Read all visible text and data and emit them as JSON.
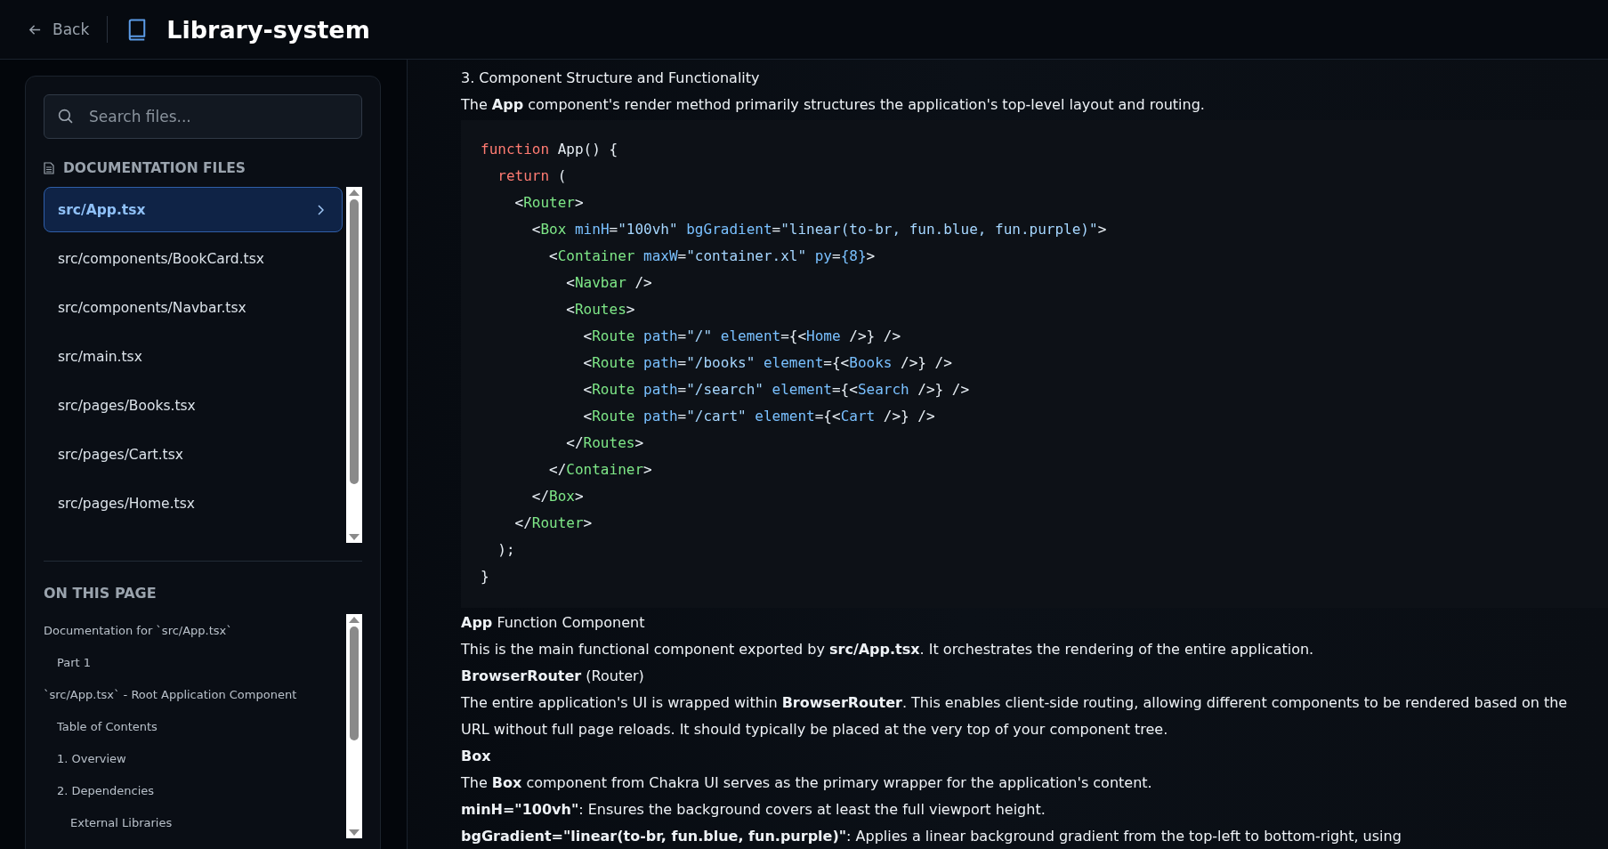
{
  "header": {
    "back": "Back",
    "title": "Library-system"
  },
  "sidebar": {
    "search": {
      "placeholder": "Search files..."
    },
    "files_heading": "DOCUMENTATION FILES",
    "files": [
      {
        "label": "src/App.tsx",
        "selected": true
      },
      {
        "label": "src/components/BookCard.tsx",
        "selected": false
      },
      {
        "label": "src/components/Navbar.tsx",
        "selected": false
      },
      {
        "label": "src/main.tsx",
        "selected": false
      },
      {
        "label": "src/pages/Books.tsx",
        "selected": false
      },
      {
        "label": "src/pages/Cart.tsx",
        "selected": false
      },
      {
        "label": "src/pages/Home.tsx",
        "selected": false
      }
    ],
    "toc_heading": "ON THIS PAGE",
    "toc": [
      {
        "label": "Documentation for `src/App.tsx`",
        "children": [
          {
            "label": "Part 1"
          }
        ]
      },
      {
        "label": "`src/App.tsx` - Root Application Component",
        "children": [
          {
            "label": "Table of Contents"
          },
          {
            "label": "1. Overview"
          },
          {
            "label": "2. Dependencies",
            "children": [
              {
                "label": "External Libraries"
              }
            ]
          }
        ]
      }
    ]
  },
  "content": {
    "blocks": [
      {
        "kind": "heading",
        "text": "3. Component Structure and Functionality"
      },
      {
        "kind": "para",
        "text": "The **App** component's render method primarily structures the application's top-level layout and routing."
      },
      {
        "kind": "code",
        "lines": [
          [
            {
              "kind": "keyword",
              "text": "function"
            },
            {
              "kind": "plain",
              "text": " App() {"
            }
          ],
          [
            {
              "kind": "keyword",
              "text": "  return"
            },
            {
              "kind": "plain",
              "text": " ("
            }
          ],
          [
            {
              "kind": "plain",
              "text": "    <"
            },
            {
              "kind": "tag",
              "text": "Router"
            },
            {
              "kind": "plain",
              "text": ">"
            }
          ],
          [
            {
              "kind": "plain",
              "text": "      <"
            },
            {
              "kind": "tag",
              "text": "Box"
            },
            {
              "kind": "attr",
              "text": " minH"
            },
            {
              "kind": "plain",
              "text": "="
            },
            {
              "kind": "string",
              "text": "\"100vh\""
            },
            {
              "kind": "attr",
              "text": " bgGradient"
            },
            {
              "kind": "plain",
              "text": "="
            },
            {
              "kind": "string",
              "text": "\"linear(to-br, fun.blue, fun.purple)\""
            },
            {
              "kind": "plain",
              "text": ">"
            }
          ],
          [
            {
              "kind": "plain",
              "text": "        <"
            },
            {
              "kind": "tag",
              "text": "Container"
            },
            {
              "kind": "attr",
              "text": " maxW"
            },
            {
              "kind": "plain",
              "text": "="
            },
            {
              "kind": "string",
              "text": "\"container.xl\""
            },
            {
              "kind": "attr",
              "text": " py"
            },
            {
              "kind": "plain",
              "text": "="
            },
            {
              "kind": "attr",
              "text": "{8}"
            },
            {
              "kind": "plain",
              "text": ">"
            }
          ],
          [
            {
              "kind": "plain",
              "text": "          <"
            },
            {
              "kind": "tag",
              "text": "Navbar"
            },
            {
              "kind": "plain",
              "text": " />"
            }
          ],
          [
            {
              "kind": "plain",
              "text": "          <"
            },
            {
              "kind": "tag",
              "text": "Routes"
            },
            {
              "kind": "plain",
              "text": ">"
            }
          ],
          [
            {
              "kind": "plain",
              "text": "            <"
            },
            {
              "kind": "tag",
              "text": "Route"
            },
            {
              "kind": "attr",
              "text": " path"
            },
            {
              "kind": "plain",
              "text": "="
            },
            {
              "kind": "string",
              "text": "\"/\""
            },
            {
              "kind": "attr",
              "text": " element"
            },
            {
              "kind": "plain",
              "text": "={<"
            },
            {
              "kind": "attr",
              "text": "Home"
            },
            {
              "kind": "plain",
              "text": " />} />"
            }
          ],
          [
            {
              "kind": "plain",
              "text": "            <"
            },
            {
              "kind": "tag",
              "text": "Route"
            },
            {
              "kind": "attr",
              "text": " path"
            },
            {
              "kind": "plain",
              "text": "="
            },
            {
              "kind": "string",
              "text": "\"/books\""
            },
            {
              "kind": "attr",
              "text": " element"
            },
            {
              "kind": "plain",
              "text": "={<"
            },
            {
              "kind": "attr",
              "text": "Books"
            },
            {
              "kind": "plain",
              "text": " />} />"
            }
          ],
          [
            {
              "kind": "plain",
              "text": "            <"
            },
            {
              "kind": "tag",
              "text": "Route"
            },
            {
              "kind": "attr",
              "text": " path"
            },
            {
              "kind": "plain",
              "text": "="
            },
            {
              "kind": "string",
              "text": "\"/search\""
            },
            {
              "kind": "attr",
              "text": " element"
            },
            {
              "kind": "plain",
              "text": "={<"
            },
            {
              "kind": "attr",
              "text": "Search"
            },
            {
              "kind": "plain",
              "text": " />} />"
            }
          ],
          [
            {
              "kind": "plain",
              "text": "            <"
            },
            {
              "kind": "tag",
              "text": "Route"
            },
            {
              "kind": "attr",
              "text": " path"
            },
            {
              "kind": "plain",
              "text": "="
            },
            {
              "kind": "string",
              "text": "\"/cart\""
            },
            {
              "kind": "attr",
              "text": " element"
            },
            {
              "kind": "plain",
              "text": "={<"
            },
            {
              "kind": "attr",
              "text": "Cart"
            },
            {
              "kind": "plain",
              "text": " />} />"
            }
          ],
          [
            {
              "kind": "plain",
              "text": "          </"
            },
            {
              "kind": "tag",
              "text": "Routes"
            },
            {
              "kind": "plain",
              "text": ">"
            }
          ],
          [
            {
              "kind": "plain",
              "text": "        </"
            },
            {
              "kind": "tag",
              "text": "Container"
            },
            {
              "kind": "plain",
              "text": ">"
            }
          ],
          [
            {
              "kind": "plain",
              "text": "      </"
            },
            {
              "kind": "tag",
              "text": "Box"
            },
            {
              "kind": "plain",
              "text": ">"
            }
          ],
          [
            {
              "kind": "plain",
              "text": "    </"
            },
            {
              "kind": "tag",
              "text": "Router"
            },
            {
              "kind": "plain",
              "text": ">"
            }
          ],
          [
            {
              "kind": "plain",
              "text": "  );"
            }
          ],
          [
            {
              "kind": "plain",
              "text": "}"
            }
          ]
        ]
      },
      {
        "kind": "heading",
        "text": "**App** Function Component"
      },
      {
        "kind": "para",
        "text": "This is the main functional component exported by **src/App.tsx**. It orchestrates the rendering of the entire application."
      },
      {
        "kind": "heading",
        "text": "**BrowserRouter** (Router)"
      },
      {
        "kind": "para",
        "text": "The entire application's UI is wrapped within **BrowserRouter**. This enables client-side routing, allowing different components to be rendered based on the URL without full page reloads. It should typically be placed at the very top of your component tree."
      },
      {
        "kind": "heading",
        "text": "**Box**"
      },
      {
        "kind": "para",
        "text": "The **Box** component from Chakra UI serves as the primary wrapper for the application's content."
      },
      {
        "kind": "para",
        "text": "**minH=\"100vh\"**: Ensures the background covers at least the full viewport height."
      },
      {
        "kind": "para",
        "text": "**bgGradient=\"linear(to-br, fun.blue, fun.purple)\"**: Applies a linear background gradient from the top-left to bottom-right, using"
      }
    ]
  }
}
